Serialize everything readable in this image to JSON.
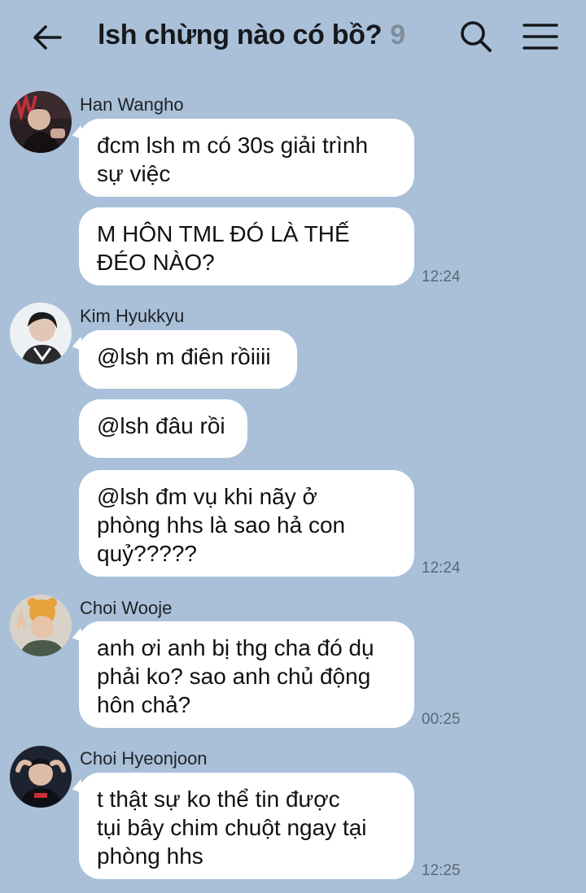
{
  "header": {
    "title": "lsh chừng nào có bồ?",
    "member_count": "9",
    "back_icon": "arrow-left-icon",
    "search_icon": "search-icon",
    "menu_icon": "hamburger-menu-icon"
  },
  "colors": {
    "background": "#a9c0d8",
    "bubble": "#ffffff",
    "muted": "#7f8d9c"
  },
  "messages": [
    {
      "sender": "Han Wangho",
      "bubbles": [
        "đcm lsh m có 30s giải trình\nsự việc",
        "M HÔN TML ĐÓ LÀ THẾ\nĐÉO NÀO?"
      ],
      "time": "12:24"
    },
    {
      "sender": "Kim Hyukkyu",
      "bubbles": [
        "@lsh m điên rồiiii",
        "@lsh đâu rồi",
        "@lsh đm vụ khi nãy ở\nphòng hhs là sao hả con\nquỷ?????"
      ],
      "time": "12:24"
    },
    {
      "sender": "Choi Wooje",
      "bubbles": [
        "anh ơi anh bị thg cha đó dụ\nphải ko? sao anh chủ động\nhôn chả?"
      ],
      "time": "00:25"
    },
    {
      "sender": "Choi Hyeonjoon",
      "bubbles": [
        "t thật sự ko thể tin được\ntụi bây chim chuột ngay tại\nphòng hhs"
      ],
      "time": "12:25"
    }
  ]
}
